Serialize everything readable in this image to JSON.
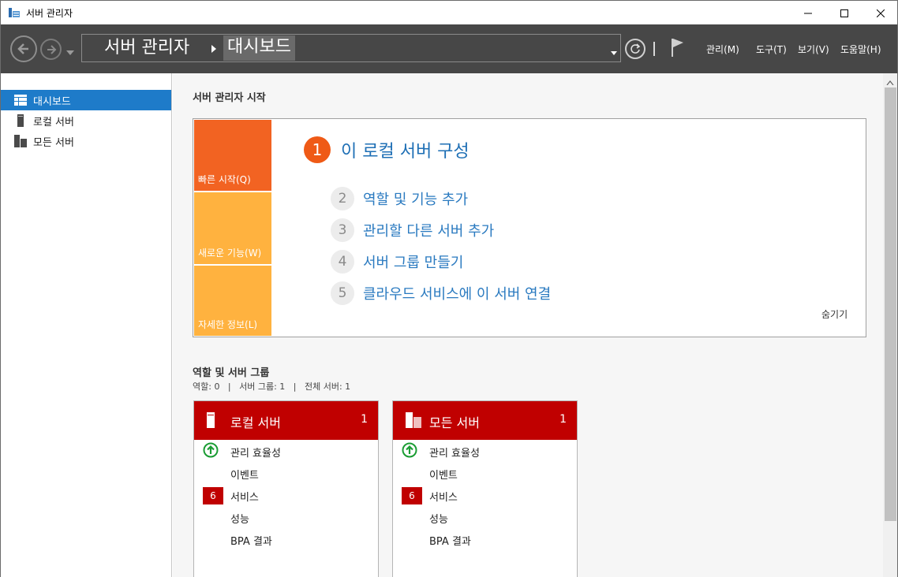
{
  "window": {
    "title": "서버 관리자"
  },
  "nav": {
    "breadcrumb_root": "서버 관리자",
    "breadcrumb_current": "대시보드",
    "menus": [
      "관리(M)",
      "도구(T)",
      "보기(V)",
      "도움말(H)"
    ]
  },
  "sidebar": {
    "items": [
      {
        "label": "대시보드",
        "icon": "dashboard-icon",
        "active": true
      },
      {
        "label": "로컬 서버",
        "icon": "server-icon",
        "active": false
      },
      {
        "label": "모든 서버",
        "icon": "servers-icon",
        "active": false
      }
    ]
  },
  "quickstart": {
    "heading": "서버 관리자 시작",
    "tiles": [
      "빠른 시작(Q)",
      "새로운 기능(W)",
      "자세한 정보(L)"
    ],
    "main_step": {
      "number": "1",
      "label": "이 로컬 서버 구성"
    },
    "steps": [
      {
        "number": "2",
        "label": "역할 및 기능 추가"
      },
      {
        "number": "3",
        "label": "관리할 다른 서버 추가"
      },
      {
        "number": "4",
        "label": "서버 그룹 만들기"
      },
      {
        "number": "5",
        "label": "클라우드 서비스에 이 서버 연결"
      }
    ],
    "hide_label": "숨기기"
  },
  "roles": {
    "heading": "역할 및 서버 그룹",
    "stats": "역할: 0   |   서버 그룹: 1   |   전체 서버: 1",
    "cards": [
      {
        "title": "로컬 서버",
        "count": "1",
        "rows": [
          {
            "label": "관리 효율성",
            "status": "ok"
          },
          {
            "label": "이벤트"
          },
          {
            "label": "서비스",
            "badge": "6"
          },
          {
            "label": "성능"
          },
          {
            "label": "BPA 결과"
          }
        ]
      },
      {
        "title": "모든 서버",
        "count": "1",
        "rows": [
          {
            "label": "관리 효율성",
            "status": "ok"
          },
          {
            "label": "이벤트"
          },
          {
            "label": "서비스",
            "badge": "6"
          },
          {
            "label": "성능"
          },
          {
            "label": "BPA 결과"
          }
        ]
      }
    ]
  },
  "colors": {
    "accent": "#1e7bc9",
    "quickstart_orange": "#f26322",
    "quickstart_yellow": "#ffb23f",
    "alert_red": "#c00000",
    "ok_green": "#1a9c33"
  }
}
